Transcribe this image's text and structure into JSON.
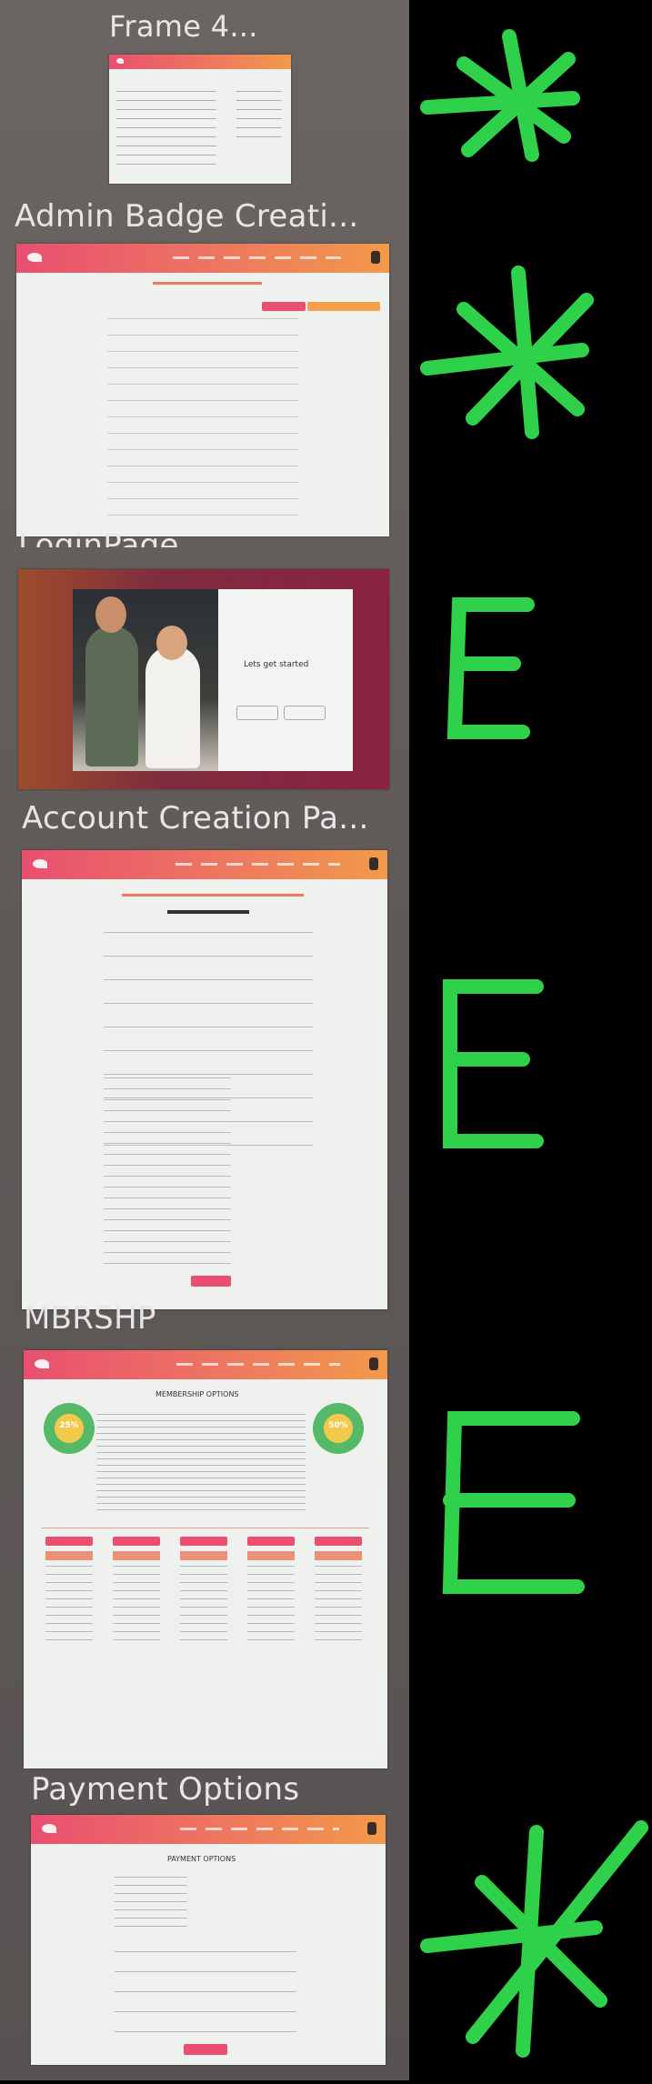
{
  "labels": {
    "frame4": "Frame 4...",
    "admin_badge": "Admin Badge Creati...",
    "login_page": "LoginPage",
    "account_creation": "Account Creation Pa...",
    "mbrshp": "MBRSHP",
    "payment_options": "Payment Options"
  },
  "thumb_text": {
    "login_heading": "Lets get started",
    "membership_heading": "MEMBERSHIP OPTIONS",
    "payment_heading": "PAYMENT OPTIONS",
    "badge_pct_left": "25%",
    "badge_pct_right": "50%"
  },
  "marks": [
    "*",
    "*",
    "E",
    "E",
    "E",
    "*"
  ],
  "colors": {
    "panel_bg": "#5f5a58",
    "header_start": "#e84f70",
    "header_end": "#f29a4a",
    "mark_green": "#2fd04a",
    "page_bg": "#eef1ed"
  },
  "icons": [
    "gear-icon",
    "logo-icon"
  ]
}
